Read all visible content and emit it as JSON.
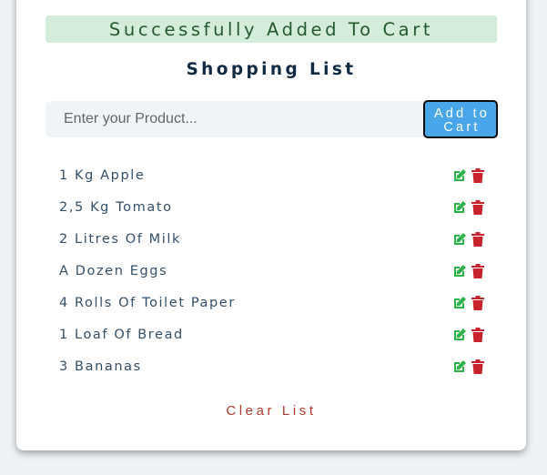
{
  "alert": {
    "text": "Successfully Added To Cart",
    "background": "#d4edda",
    "color": "#235a2f"
  },
  "title": "Shopping List",
  "form": {
    "placeholder": "Enter your Product...",
    "value": "",
    "submit_label": "Add to Cart"
  },
  "items": [
    {
      "name": "1 Kg Apple",
      "edit_icon": "edit-icon",
      "delete_icon": "trash-icon"
    },
    {
      "name": "2,5 Kg Tomato",
      "edit_icon": "edit-icon",
      "delete_icon": "trash-icon"
    },
    {
      "name": "2 Litres Of Milk",
      "edit_icon": "edit-icon",
      "delete_icon": "trash-icon"
    },
    {
      "name": "A Dozen Eggs",
      "edit_icon": "edit-icon",
      "delete_icon": "trash-icon"
    },
    {
      "name": "4 Rolls Of Toilet Paper",
      "edit_icon": "edit-icon",
      "delete_icon": "trash-icon"
    },
    {
      "name": "1 Loaf Of Bread",
      "edit_icon": "edit-icon",
      "delete_icon": "trash-icon"
    },
    {
      "name": "3 Bananas",
      "edit_icon": "edit-icon",
      "delete_icon": "trash-icon"
    }
  ],
  "clear_label": "Clear List",
  "colors": {
    "accent": "#49a6e9",
    "edit": "#2db34a",
    "delete": "#c8232c",
    "clear": "#b13a2e"
  }
}
